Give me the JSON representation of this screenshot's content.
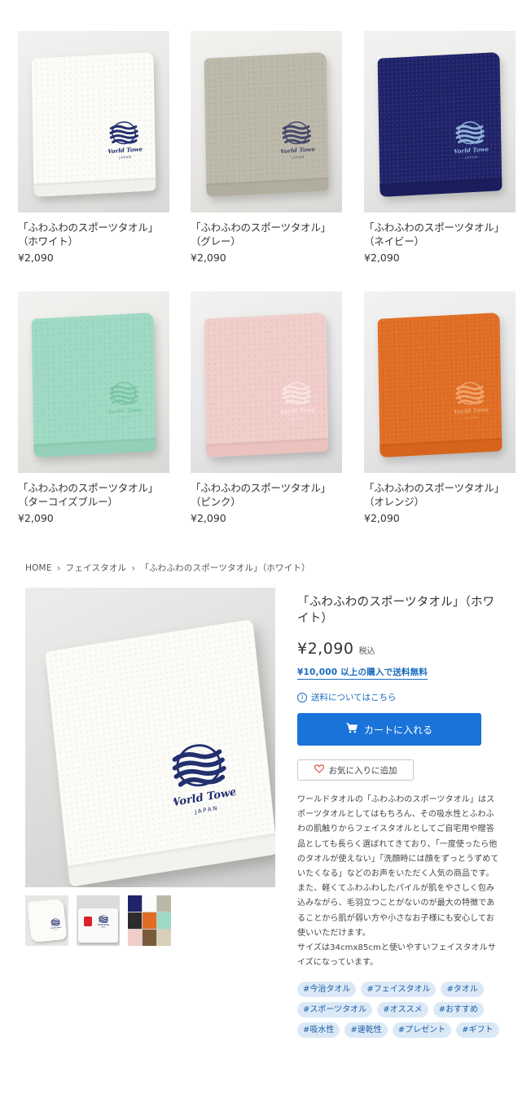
{
  "products": [
    {
      "name_line1": "「ふわふわのスポーツタオル」",
      "name_line2": "（ホワイト）",
      "price": "¥2,090",
      "color": "#fbfbf8",
      "hem": "#f1f1ec",
      "bg": "#e4e4e2",
      "logo": "#23306e"
    },
    {
      "name_line1": "「ふわふわのスポーツタオル」",
      "name_line2": "（グレー）",
      "price": "¥2,090",
      "color": "#bcb8a9",
      "hem": "#b2ae9f",
      "bg": "#e7e6e2",
      "logo": "#45496b"
    },
    {
      "name_line1": "「ふわふわのスポーツタオル」",
      "name_line2": "（ネイビー）",
      "price": "¥2,090",
      "color": "#1f2369",
      "hem": "#1a1e5c",
      "bg": "#e8e8e6",
      "logo": "#8fb2d9"
    },
    {
      "name_line1": "「ふわふわのスポーツタオル」",
      "name_line2": "（ターコイズブルー）",
      "price": "¥2,090",
      "color": "#9ed9c3",
      "hem": "#94d0b9",
      "bg": "#e6e6e3",
      "logo": "#7cc5a9"
    },
    {
      "name_line1": "「ふわふわのスポーツタオル」",
      "name_line2": "（ピンク）",
      "price": "¥2,090",
      "color": "#f1cdca",
      "hem": "#ebc2be",
      "bg": "#e7e6e9",
      "logo": "#f7e4e1"
    },
    {
      "name_line1": "「ふわふわのスポーツタオル」",
      "name_line2": "（オレンジ）",
      "price": "¥2,090",
      "color": "#e06d23",
      "hem": "#d6641c",
      "bg": "#e8e8ea",
      "logo": "#f0a36a"
    }
  ],
  "breadcrumb": {
    "home": "HOME",
    "sep_icon": "chevron-right-icon",
    "category": "フェイスタオル",
    "current": "「ふわふわのスポーツタオル」（ホワイト）",
    "separator": "›"
  },
  "detail": {
    "title": "「ふわふわのスポーツタオル」（ホワイト）",
    "price": "¥2,090",
    "tax_label": "税込",
    "free_shipping": "¥10,000 以上の購入で送料無料",
    "shipping_info": "送料についてはこちら",
    "info_icon_glyph": "i",
    "cart_label": "カートに入れる",
    "cart_icon": "cart-icon",
    "favorite_label": "お気に入りに追加",
    "favorite_icon": "heart-icon",
    "description": [
      "ワールドタオルの「ふわふわのスポーツタオル」はスポーツタオルとしてはもちろん、その吸水性とふわふわの肌触りからフェイスタオルとしてご自宅用や贈答品としても長らく選ばれてきており、「一度使ったら他のタオルが使えない」「洗顔時には顔をずっとうずめていたくなる」などのお声をいただく人気の商品です。",
      "また、軽くてふわふわしたパイルが肌をやさしく包み込みながら、毛羽立つことがないのが最大の特徴であることから肌が弱い方や小さなお子様にも安心してお使いいただけます。",
      "サイズは34cmx85cmと使いやすいフェイスタオルサイズになっています。"
    ],
    "tags": [
      "#今治タオル",
      "#フェイスタオル",
      "#タオル",
      "#スポーツタオル",
      "#オススメ",
      "#おすすめ",
      "#吸水性",
      "#速乾性",
      "#プレゼント",
      "#ギフト"
    ]
  },
  "colors": {
    "accent": "#1a73d9",
    "link": "#1a6bbf",
    "tag_bg": "#dbe9f7",
    "tag_text": "#1e5fa6",
    "main_towel": "#fbfbf8",
    "main_logo": "#23306e"
  }
}
